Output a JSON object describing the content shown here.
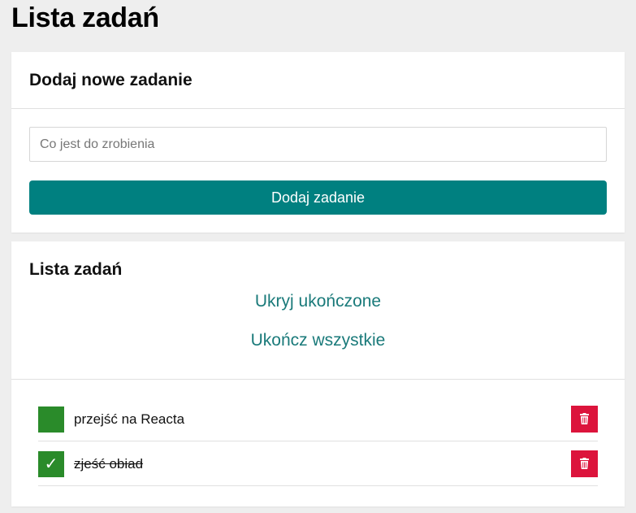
{
  "page": {
    "title": "Lista zadań"
  },
  "add_task": {
    "title": "Dodaj nowe zadanie",
    "input_value": "",
    "input_placeholder": "Co jest do zrobienia",
    "button_label": "Dodaj zadanie"
  },
  "task_list": {
    "title": "Lista zadań",
    "hide_completed_label": "Ukryj ukończone",
    "complete_all_label": "Ukończ wszystkie",
    "items": [
      {
        "label": "przejść na Reacta",
        "completed": false,
        "checkbox_icon": "",
        "delete_icon": "trash-icon"
      },
      {
        "label": "zjeść obiad",
        "completed": true,
        "checkbox_icon": "✓",
        "delete_icon": "trash-icon"
      }
    ]
  },
  "colors": {
    "background": "#eeeeee",
    "accent": "#008080",
    "link": "#1a7a7a",
    "checkbox": "#2a8b2a",
    "delete": "#dc143c"
  }
}
